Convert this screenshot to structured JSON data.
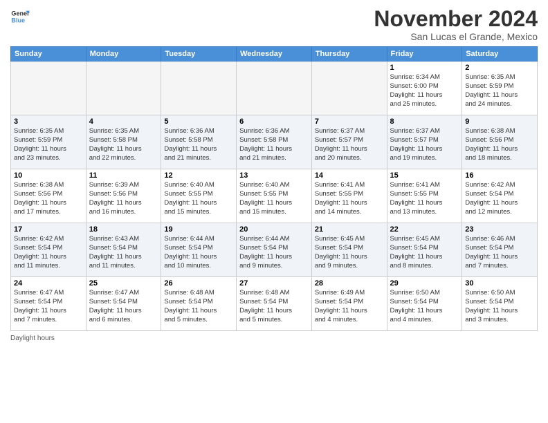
{
  "header": {
    "logo_line1": "General",
    "logo_line2": "Blue",
    "month_title": "November 2024",
    "location": "San Lucas el Grande, Mexico"
  },
  "days_of_week": [
    "Sunday",
    "Monday",
    "Tuesday",
    "Wednesday",
    "Thursday",
    "Friday",
    "Saturday"
  ],
  "footer": {
    "note": "Daylight hours"
  },
  "weeks": [
    {
      "row_alt": false,
      "days": [
        {
          "num": "",
          "info": ""
        },
        {
          "num": "",
          "info": ""
        },
        {
          "num": "",
          "info": ""
        },
        {
          "num": "",
          "info": ""
        },
        {
          "num": "",
          "info": ""
        },
        {
          "num": "1",
          "info": "Sunrise: 6:34 AM\nSunset: 6:00 PM\nDaylight: 11 hours\nand 25 minutes."
        },
        {
          "num": "2",
          "info": "Sunrise: 6:35 AM\nSunset: 5:59 PM\nDaylight: 11 hours\nand 24 minutes."
        }
      ]
    },
    {
      "row_alt": true,
      "days": [
        {
          "num": "3",
          "info": "Sunrise: 6:35 AM\nSunset: 5:59 PM\nDaylight: 11 hours\nand 23 minutes."
        },
        {
          "num": "4",
          "info": "Sunrise: 6:35 AM\nSunset: 5:58 PM\nDaylight: 11 hours\nand 22 minutes."
        },
        {
          "num": "5",
          "info": "Sunrise: 6:36 AM\nSunset: 5:58 PM\nDaylight: 11 hours\nand 21 minutes."
        },
        {
          "num": "6",
          "info": "Sunrise: 6:36 AM\nSunset: 5:58 PM\nDaylight: 11 hours\nand 21 minutes."
        },
        {
          "num": "7",
          "info": "Sunrise: 6:37 AM\nSunset: 5:57 PM\nDaylight: 11 hours\nand 20 minutes."
        },
        {
          "num": "8",
          "info": "Sunrise: 6:37 AM\nSunset: 5:57 PM\nDaylight: 11 hours\nand 19 minutes."
        },
        {
          "num": "9",
          "info": "Sunrise: 6:38 AM\nSunset: 5:56 PM\nDaylight: 11 hours\nand 18 minutes."
        }
      ]
    },
    {
      "row_alt": false,
      "days": [
        {
          "num": "10",
          "info": "Sunrise: 6:38 AM\nSunset: 5:56 PM\nDaylight: 11 hours\nand 17 minutes."
        },
        {
          "num": "11",
          "info": "Sunrise: 6:39 AM\nSunset: 5:56 PM\nDaylight: 11 hours\nand 16 minutes."
        },
        {
          "num": "12",
          "info": "Sunrise: 6:40 AM\nSunset: 5:55 PM\nDaylight: 11 hours\nand 15 minutes."
        },
        {
          "num": "13",
          "info": "Sunrise: 6:40 AM\nSunset: 5:55 PM\nDaylight: 11 hours\nand 15 minutes."
        },
        {
          "num": "14",
          "info": "Sunrise: 6:41 AM\nSunset: 5:55 PM\nDaylight: 11 hours\nand 14 minutes."
        },
        {
          "num": "15",
          "info": "Sunrise: 6:41 AM\nSunset: 5:55 PM\nDaylight: 11 hours\nand 13 minutes."
        },
        {
          "num": "16",
          "info": "Sunrise: 6:42 AM\nSunset: 5:54 PM\nDaylight: 11 hours\nand 12 minutes."
        }
      ]
    },
    {
      "row_alt": true,
      "days": [
        {
          "num": "17",
          "info": "Sunrise: 6:42 AM\nSunset: 5:54 PM\nDaylight: 11 hours\nand 11 minutes."
        },
        {
          "num": "18",
          "info": "Sunrise: 6:43 AM\nSunset: 5:54 PM\nDaylight: 11 hours\nand 11 minutes."
        },
        {
          "num": "19",
          "info": "Sunrise: 6:44 AM\nSunset: 5:54 PM\nDaylight: 11 hours\nand 10 minutes."
        },
        {
          "num": "20",
          "info": "Sunrise: 6:44 AM\nSunset: 5:54 PM\nDaylight: 11 hours\nand 9 minutes."
        },
        {
          "num": "21",
          "info": "Sunrise: 6:45 AM\nSunset: 5:54 PM\nDaylight: 11 hours\nand 9 minutes."
        },
        {
          "num": "22",
          "info": "Sunrise: 6:45 AM\nSunset: 5:54 PM\nDaylight: 11 hours\nand 8 minutes."
        },
        {
          "num": "23",
          "info": "Sunrise: 6:46 AM\nSunset: 5:54 PM\nDaylight: 11 hours\nand 7 minutes."
        }
      ]
    },
    {
      "row_alt": false,
      "days": [
        {
          "num": "24",
          "info": "Sunrise: 6:47 AM\nSunset: 5:54 PM\nDaylight: 11 hours\nand 7 minutes."
        },
        {
          "num": "25",
          "info": "Sunrise: 6:47 AM\nSunset: 5:54 PM\nDaylight: 11 hours\nand 6 minutes."
        },
        {
          "num": "26",
          "info": "Sunrise: 6:48 AM\nSunset: 5:54 PM\nDaylight: 11 hours\nand 5 minutes."
        },
        {
          "num": "27",
          "info": "Sunrise: 6:48 AM\nSunset: 5:54 PM\nDaylight: 11 hours\nand 5 minutes."
        },
        {
          "num": "28",
          "info": "Sunrise: 6:49 AM\nSunset: 5:54 PM\nDaylight: 11 hours\nand 4 minutes."
        },
        {
          "num": "29",
          "info": "Sunrise: 6:50 AM\nSunset: 5:54 PM\nDaylight: 11 hours\nand 4 minutes."
        },
        {
          "num": "30",
          "info": "Sunrise: 6:50 AM\nSunset: 5:54 PM\nDaylight: 11 hours\nand 3 minutes."
        }
      ]
    }
  ]
}
